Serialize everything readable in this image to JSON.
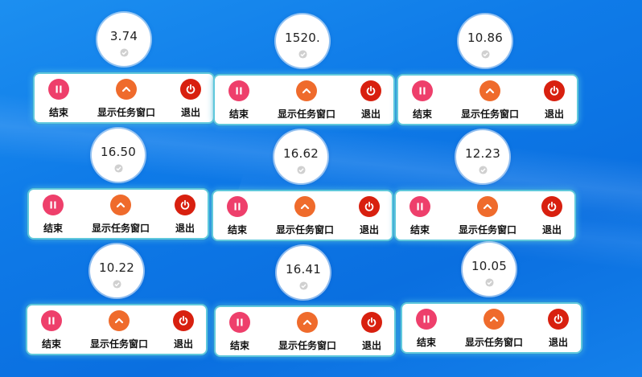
{
  "labels": {
    "stop": "结束",
    "show_task_window": "显示任务窗口",
    "exit": "退出"
  },
  "colors": {
    "stop_button": "#ee3f6b",
    "show_button": "#ef6b2c",
    "exit_button": "#d8200f",
    "panel_border": "#5fc8dc"
  },
  "icons": {
    "stop": "pause-icon",
    "show": "chevron-up-icon",
    "exit": "power-icon",
    "timer": "check-icon"
  },
  "widgets": [
    {
      "timer": "3.74"
    },
    {
      "timer": "1520."
    },
    {
      "timer": "10.86"
    },
    {
      "timer": "16.50"
    },
    {
      "timer": "16.62"
    },
    {
      "timer": "12.23"
    },
    {
      "timer": "10.22"
    },
    {
      "timer": "16.41"
    },
    {
      "timer": "10.05"
    }
  ]
}
